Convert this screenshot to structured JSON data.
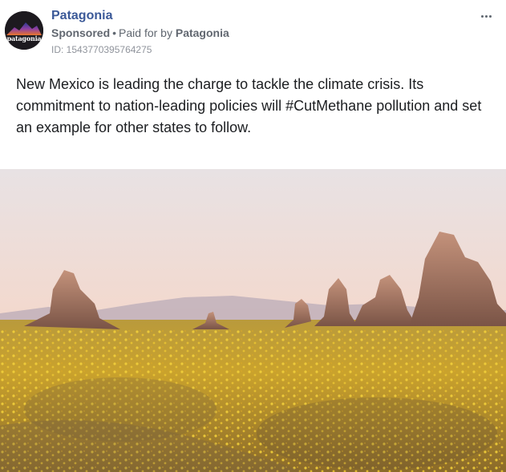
{
  "post": {
    "page_name": "Patagonia",
    "avatar_text": "patagonia",
    "sponsored_label": "Sponsored",
    "dot": "•",
    "paid_for_prefix": "Paid for by",
    "paid_for_name": "Patagonia",
    "ad_id": "ID: 1543770395764275",
    "more_icon": "more-horizontal-icon",
    "body_text": "New Mexico is leading the charge to tackle the climate crisis. Its commitment to nation-leading policies will #CutMethane pollution and set an example for other states to follow.",
    "image_subject": "Desert rock spires with a field of yellow wildflowers at sunset"
  },
  "colors": {
    "page_name": "#3b5998",
    "meta_text": "#606770",
    "id_text": "#90949c",
    "body_text": "#1c1e21"
  }
}
